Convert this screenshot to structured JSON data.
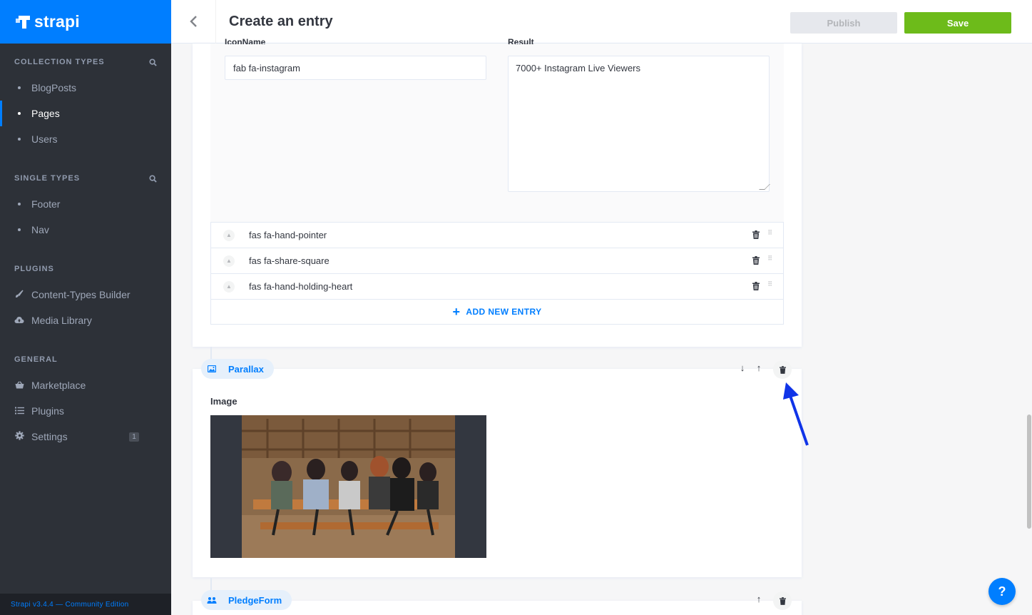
{
  "app": {
    "brand": "strapi",
    "version_text": "Strapi v3.4.4 — Community Edition"
  },
  "sidebar": {
    "collection_types": {
      "title": "COLLECTION TYPES",
      "items": [
        "BlogPosts",
        "Pages",
        "Users"
      ],
      "active": "Pages"
    },
    "single_types": {
      "title": "SINGLE TYPES",
      "items": [
        "Footer",
        "Nav"
      ]
    },
    "plugins": {
      "title": "PLUGINS",
      "items": [
        {
          "label": "Content-Types Builder",
          "icon": "paintbrush-icon"
        },
        {
          "label": "Media Library",
          "icon": "cloud-upload-icon"
        }
      ]
    },
    "general": {
      "title": "GENERAL",
      "items": [
        {
          "label": "Marketplace",
          "icon": "basket-icon"
        },
        {
          "label": "Plugins",
          "icon": "list-icon"
        },
        {
          "label": "Settings",
          "icon": "gear-icon",
          "badge": "1"
        }
      ]
    }
  },
  "header": {
    "title": "Create an entry",
    "publish_label": "Publish",
    "save_label": "Save"
  },
  "entry": {
    "icon_name_value": "fab fa-instagram",
    "result_value": "7000+ Instagram Live Viewers",
    "list_items": [
      "fas fa-hand-pointer",
      "fas fa-share-square",
      "fas fa-hand-holding-heart"
    ],
    "add_new_entry": "ADD NEW ENTRY"
  },
  "components": {
    "parallax": {
      "name": "Parallax",
      "image_label": "Image"
    },
    "pledge": {
      "name": "PledgeForm"
    }
  },
  "help": "?",
  "colors": {
    "primary": "#007eff",
    "save": "#6dbb1a",
    "sidebar": "#2d3138",
    "arrow": "#1034e8"
  }
}
